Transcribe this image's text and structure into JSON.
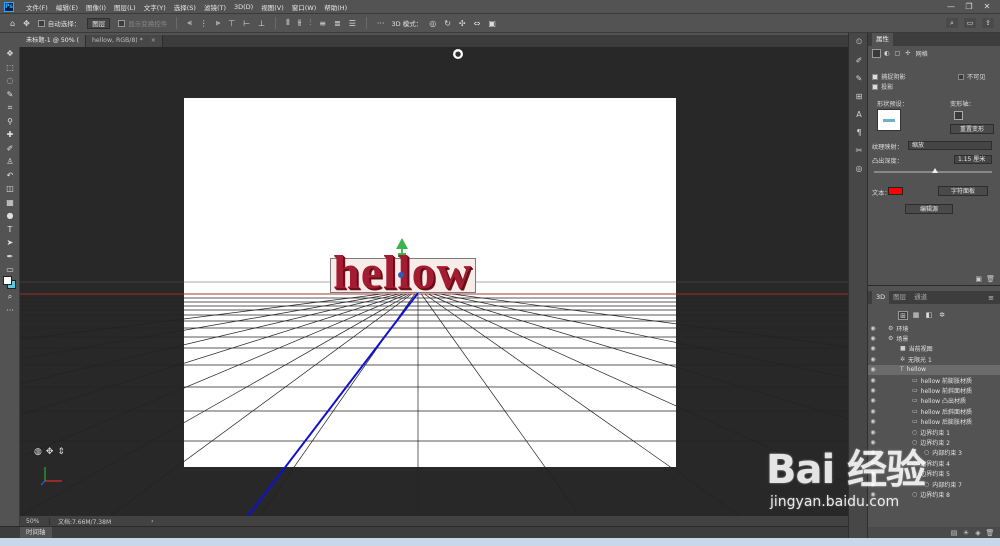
{
  "app": {
    "logo": "Ps",
    "menu": [
      "文件(F)",
      "编辑(E)",
      "图像(I)",
      "图层(L)",
      "文字(Y)",
      "选择(S)",
      "滤镜(T)",
      "3D(D)",
      "视图(V)",
      "窗口(W)",
      "帮助(H)"
    ],
    "window_controls": [
      "—",
      "❐",
      "✕"
    ]
  },
  "options_bar": {
    "home_icon": "⌂",
    "move_icon": "✥",
    "auto_select_label": "自动选择：",
    "auto_select_value": "图层",
    "show_transform_label": "显示变换控件",
    "more_icon": "···",
    "mode_label": "3D 模式："
  },
  "tabs": [
    {
      "label": "未标题-1 @ 50% (",
      "active": true
    },
    {
      "label": "hellow, RGB/8) *",
      "active": false
    }
  ],
  "canvas": {
    "text": "hellow",
    "text_color": "#a41c32",
    "grid_color": "#222222",
    "axis_colors": {
      "x": "#ff0000",
      "y": "#00aa00",
      "z": "#0000ff"
    }
  },
  "status": {
    "zoom": "50%",
    "doc": "文档:7.66M/7.38M"
  },
  "timeline": {
    "label": "时间轴"
  },
  "properties": {
    "tab_label": "属性",
    "sub_label": "网格",
    "catch_shadow": "捕捉阴影",
    "cast_shadow": "投影",
    "invisible": "不可见",
    "shape_preset": "形状预设：",
    "deform_axis": "变形轴：",
    "reset_deform": "重置变形",
    "texture_map_label": "纹理映射：",
    "texture_map_value": "缩放",
    "extrusion_label": "凸出深度：",
    "extrusion_value": "1.15 厘米",
    "text_label": "文本：",
    "text_color": "#ff0000",
    "char_panel": "字符面板",
    "edit_source": "编辑源"
  },
  "panel3d": {
    "tabs": [
      "3D",
      "图层",
      "通道"
    ],
    "rows": [
      {
        "label": "环境",
        "indent": 10,
        "icon": "⚙"
      },
      {
        "label": "场景",
        "indent": 10,
        "icon": "⚙"
      },
      {
        "label": "当前视图",
        "indent": 22,
        "icon": "■"
      },
      {
        "label": "无限光 1",
        "indent": 22,
        "icon": "✲"
      },
      {
        "label": "hellow",
        "indent": 22,
        "icon": "T",
        "selected": true
      },
      {
        "label": "hellow 前膨胀材质",
        "indent": 34,
        "icon": "▭"
      },
      {
        "label": "hellow 前斜面材质",
        "indent": 34,
        "icon": "▭"
      },
      {
        "label": "hellow 凸出材质",
        "indent": 34,
        "icon": "▭"
      },
      {
        "label": "hellow 后斜面材质",
        "indent": 34,
        "icon": "▭"
      },
      {
        "label": "hellow 后膨胀材质",
        "indent": 34,
        "icon": "▭"
      },
      {
        "label": "边界约束 1",
        "indent": 34,
        "icon": "○"
      },
      {
        "label": "边界约束 2",
        "indent": 34,
        "icon": "○"
      },
      {
        "label": "内部约束 3",
        "indent": 46,
        "icon": "○"
      },
      {
        "label": "边界约束 4",
        "indent": 34,
        "icon": "○"
      },
      {
        "label": "边界约束 5",
        "indent": 34,
        "icon": "○"
      },
      {
        "label": "内部约束 7",
        "indent": 46,
        "icon": "○"
      },
      {
        "label": "边界约束 8",
        "indent": 34,
        "icon": "○"
      }
    ]
  },
  "watermark": {
    "logo": "Bai 经验",
    "url": "jingyan.baidu.com"
  }
}
